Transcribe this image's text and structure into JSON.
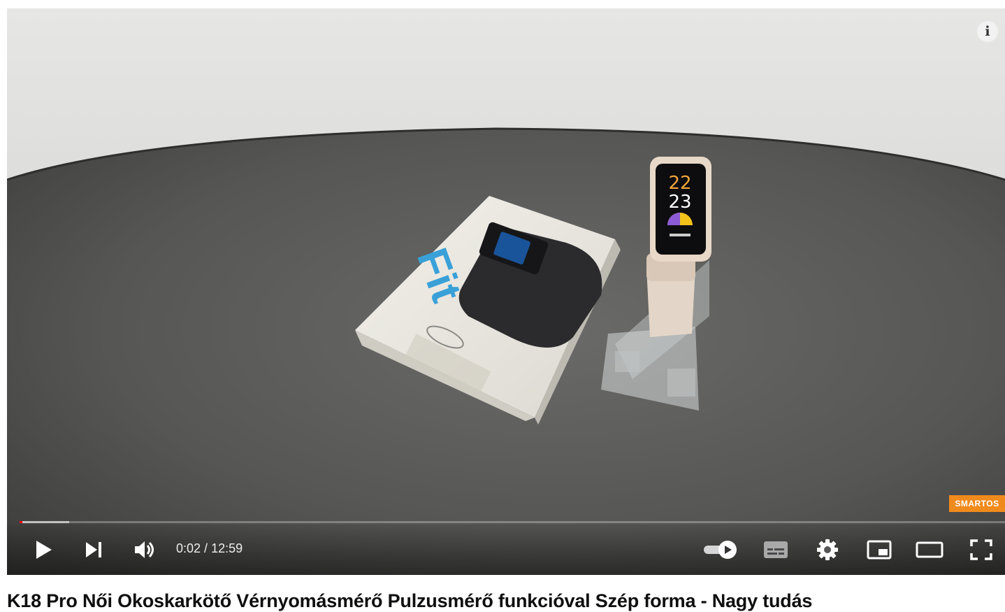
{
  "player": {
    "time_current": "0:02",
    "time_separator": " / ",
    "time_total": "12:59",
    "progress_played_fraction": 0.0026,
    "progress_buffered_fraction": 0.05,
    "autoplay_on": true,
    "info_label": "i",
    "watermark_text": "SMARTOS"
  },
  "video_scene": {
    "box_brand_text": "Fit",
    "watch_display_line1": "22",
    "watch_display_line2": "23"
  },
  "video": {
    "title": "K18 Pro Női Okoskarkötő Vérnyomásmérő Pulzusmérő funkcióval Szép forma - Nagy tudás"
  },
  "colors": {
    "progress_played": "#ff0000",
    "controls_icon": "#ffffff",
    "title_text": "#0f0f0f"
  },
  "icons": {
    "play": "play-icon",
    "next": "next-icon",
    "volume": "volume-icon",
    "autoplay": "autoplay-toggle-icon",
    "subtitles": "subtitles-icon",
    "settings": "gear-icon",
    "miniplayer": "miniplayer-icon",
    "theater": "theater-mode-icon",
    "fullscreen": "fullscreen-icon",
    "info": "info-icon"
  }
}
